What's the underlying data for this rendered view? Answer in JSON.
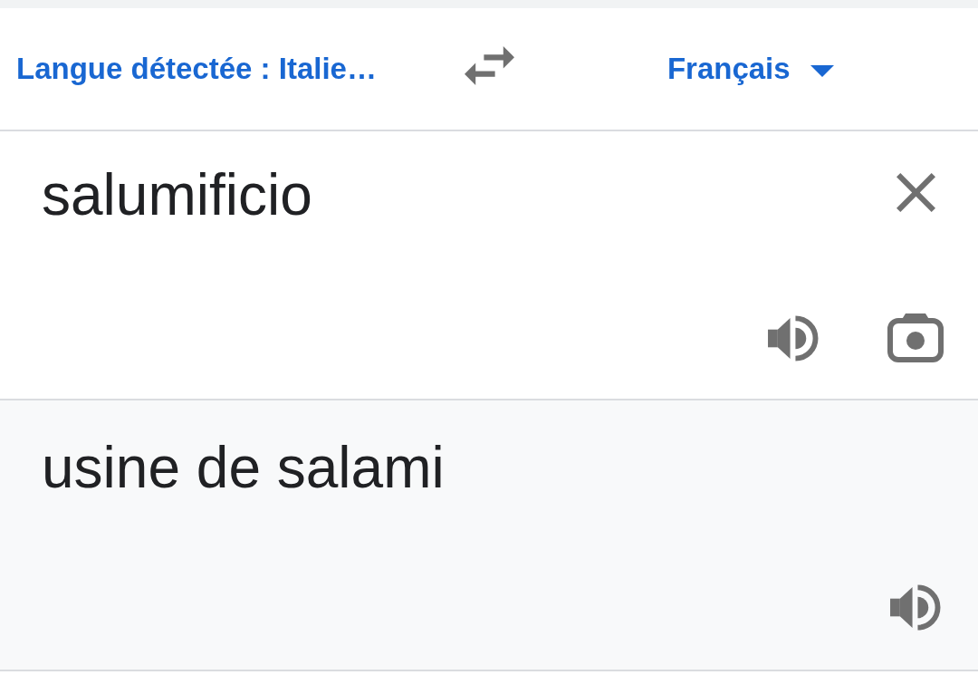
{
  "language_bar": {
    "source_language": "Langue détectée : Italie…",
    "target_language": "Français"
  },
  "source": {
    "value": "salumificio"
  },
  "translation": {
    "text": "usine de salami"
  }
}
